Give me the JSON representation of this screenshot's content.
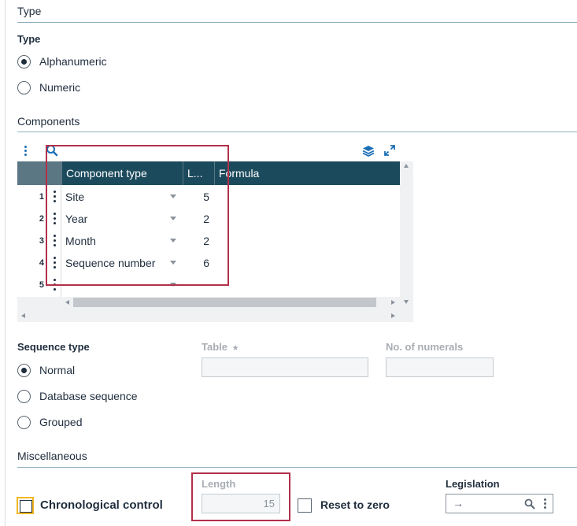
{
  "type_section": {
    "title": "Type",
    "field_label": "Type",
    "options": [
      {
        "label": "Alphanumeric",
        "checked": true
      },
      {
        "label": "Numeric",
        "checked": false
      }
    ]
  },
  "components_section": {
    "title": "Components",
    "grid": {
      "columns": [
        "Component type",
        "L...",
        "Formula"
      ],
      "rows": [
        {
          "num": "1",
          "type": "Site",
          "length": "5"
        },
        {
          "num": "2",
          "type": "Year",
          "length": "2"
        },
        {
          "num": "3",
          "type": "Month",
          "length": "2"
        },
        {
          "num": "4",
          "type": "Sequence number",
          "length": "6"
        },
        {
          "num": "5",
          "type": "",
          "length": ""
        }
      ]
    }
  },
  "sequence_type": {
    "field_label": "Sequence type",
    "options": [
      {
        "label": "Normal",
        "checked": true
      },
      {
        "label": "Database sequence",
        "checked": false
      },
      {
        "label": "Grouped",
        "checked": false
      }
    ],
    "table_label": "Table",
    "table_required_mark": "★",
    "numerals_label": "No. of numerals"
  },
  "misc_section": {
    "title": "Miscellaneous",
    "chronological_label": "Chronological control",
    "length_label": "Length",
    "length_value": "15",
    "reset_label": "Reset to zero",
    "legislation_label": "Legislation",
    "legislation_arrow": "→"
  },
  "colors": {
    "grid_header": "#1c4a5d",
    "highlight": "#b3304a",
    "focus": "#f2b824",
    "accent": "#1a6fb5"
  }
}
